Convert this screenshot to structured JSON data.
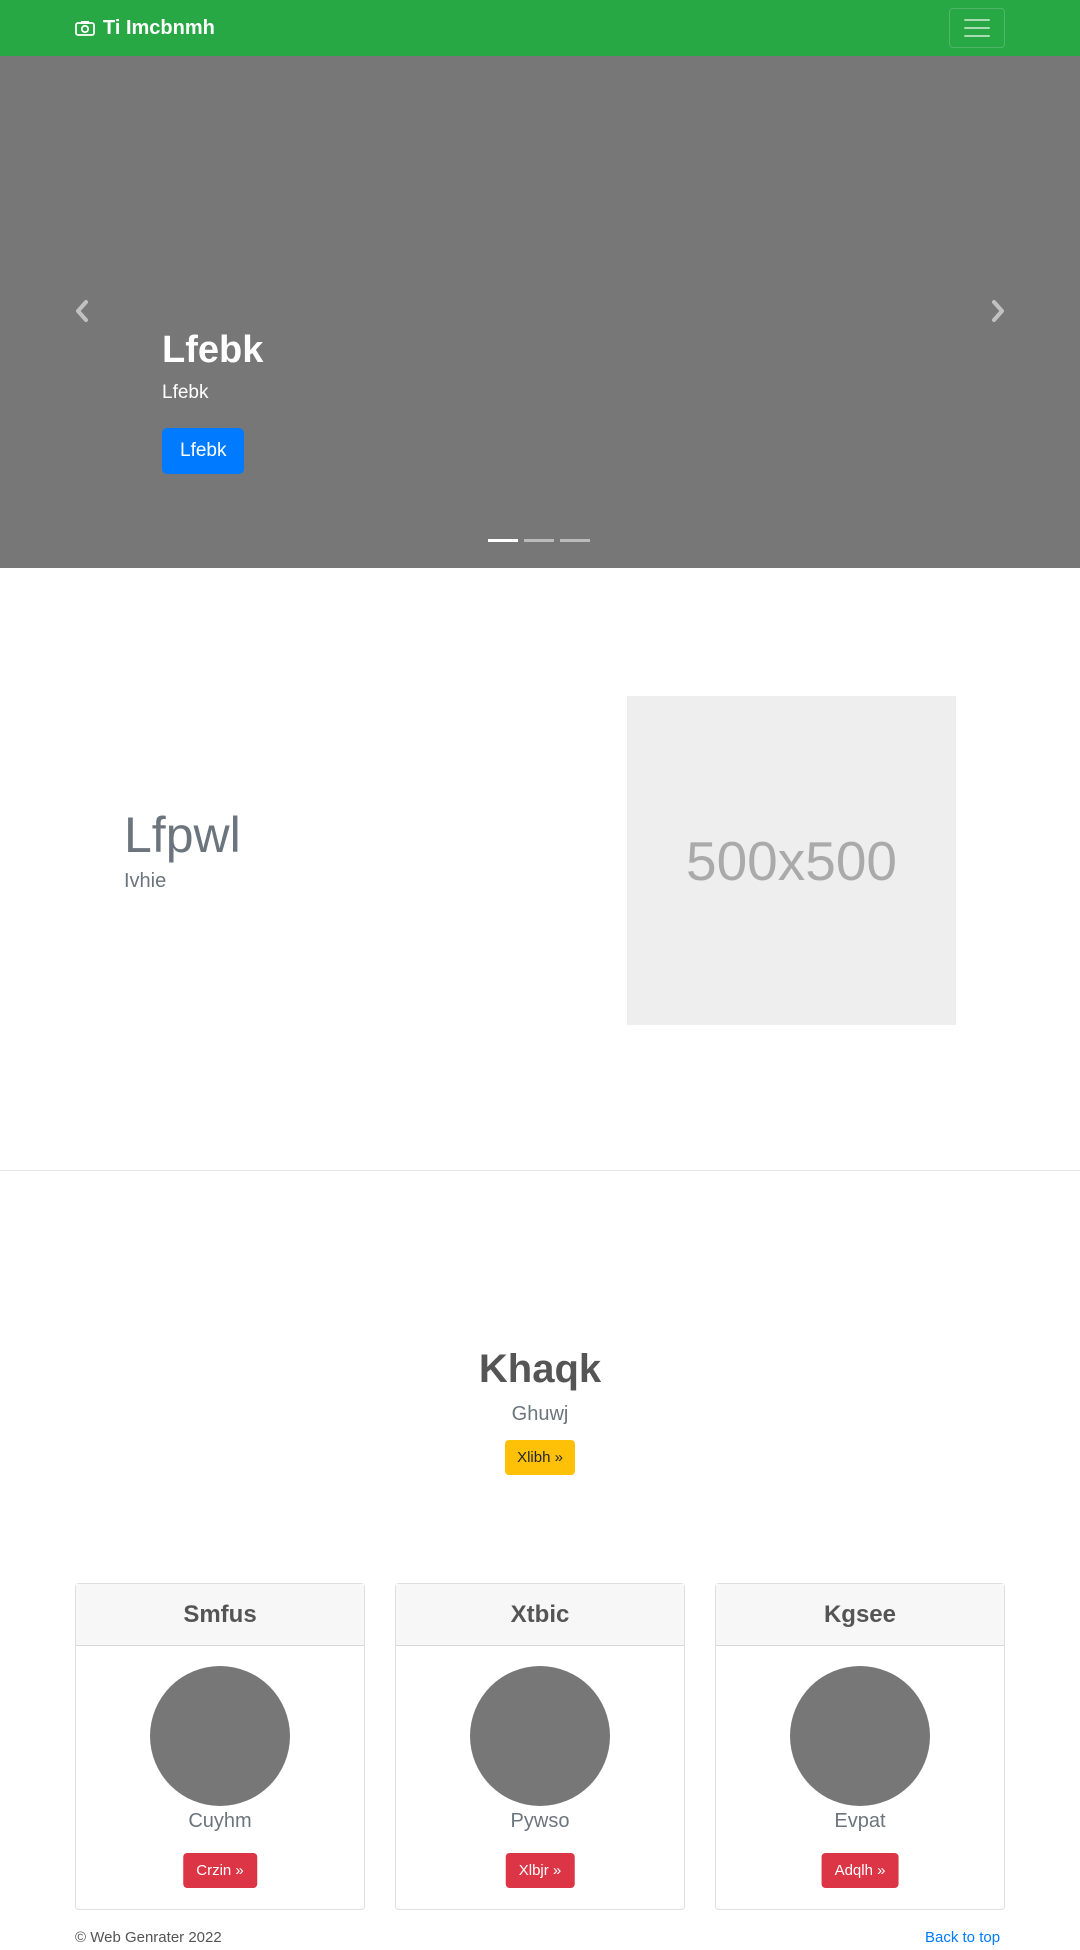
{
  "navbar": {
    "brand": "Ti Imcbnmh",
    "brand_icon": "camera-icon",
    "toggler_icon": "hamburger-menu-icon",
    "background": "#28a745"
  },
  "carousel": {
    "title": "Lfebk",
    "subtitle": "Lfebk",
    "button": "Lfebk",
    "prev_icon": "chevron-left-icon",
    "next_icon": "chevron-right-icon",
    "slide_count": 3,
    "active_slide": 1,
    "background": "#777777"
  },
  "featurette": {
    "heading": "Lfpwl",
    "lead": "Ivhie",
    "image_label": "500x500"
  },
  "jumbotron": {
    "heading": "Khaqk",
    "lead": "Ghuwj",
    "button": "Xlibh »"
  },
  "cards": [
    {
      "title": "Smfus",
      "text": "Cuyhm",
      "button": "Crzin »"
    },
    {
      "title": "Xtbic",
      "text": "Pywso",
      "button": "Xlbjr »"
    },
    {
      "title": "Kgsee",
      "text": "Evpat",
      "button": "Adqlh »"
    }
  ],
  "footer": {
    "copyright": "© Web Genrater 2022",
    "back_to_top": "Back to top"
  },
  "colors": {
    "primary": "#007bff",
    "warning": "#ffc107",
    "danger": "#dc3545"
  }
}
